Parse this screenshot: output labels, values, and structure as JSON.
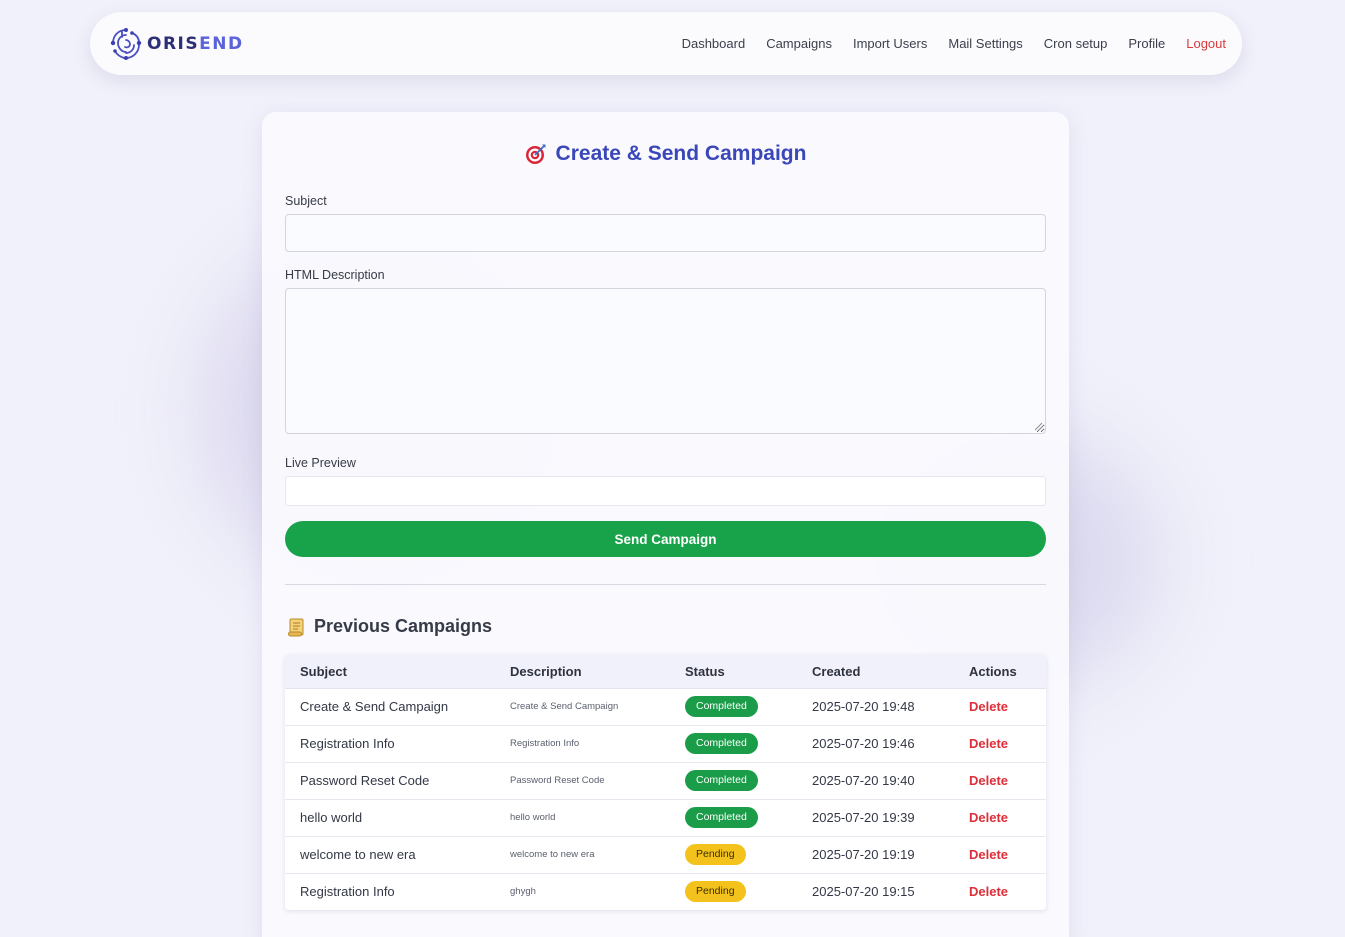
{
  "brand": {
    "name_part1": "ORIS",
    "name_part2": "END",
    "logo_icon": "circuit-logo-icon"
  },
  "nav": {
    "items": [
      {
        "label": "Dashboard"
      },
      {
        "label": "Campaigns"
      },
      {
        "label": "Import Users"
      },
      {
        "label": "Mail Settings"
      },
      {
        "label": "Cron setup"
      },
      {
        "label": "Profile"
      }
    ],
    "logout_label": "Logout"
  },
  "form": {
    "title": "Create & Send Campaign",
    "title_icon": "target-icon",
    "subject_label": "Subject",
    "subject_value": "",
    "description_label": "HTML Description",
    "description_value": "",
    "preview_label": "Live Preview",
    "send_label": "Send Campaign"
  },
  "campaigns": {
    "title": "Previous Campaigns",
    "title_icon": "scroll-icon",
    "columns": [
      "Subject",
      "Description",
      "Status",
      "Created",
      "Actions"
    ],
    "rows": [
      {
        "subject": "Create & Send Campaign",
        "description": "Create & Send Campaign",
        "status": "Completed",
        "created": "2025-07-20 19:48",
        "action": "Delete"
      },
      {
        "subject": "Registration Info",
        "description": "Registration Info",
        "status": "Completed",
        "created": "2025-07-20 19:46",
        "action": "Delete"
      },
      {
        "subject": "Password Reset Code",
        "description": "Password Reset Code",
        "status": "Completed",
        "created": "2025-07-20 19:40",
        "action": "Delete"
      },
      {
        "subject": "hello world",
        "description": "hello world",
        "status": "Completed",
        "created": "2025-07-20 19:39",
        "action": "Delete"
      },
      {
        "subject": "welcome to new era",
        "description": "welcome to new era",
        "status": "Pending",
        "created": "2025-07-20 19:19",
        "action": "Delete"
      },
      {
        "subject": "Registration Info",
        "description": "ghygh",
        "status": "Pending",
        "created": "2025-07-20 19:15",
        "action": "Delete"
      }
    ]
  },
  "colors": {
    "accent": "#3a47b8",
    "success": "#18a34a",
    "warning": "#f4c21c",
    "danger": "#dc2f3a"
  }
}
